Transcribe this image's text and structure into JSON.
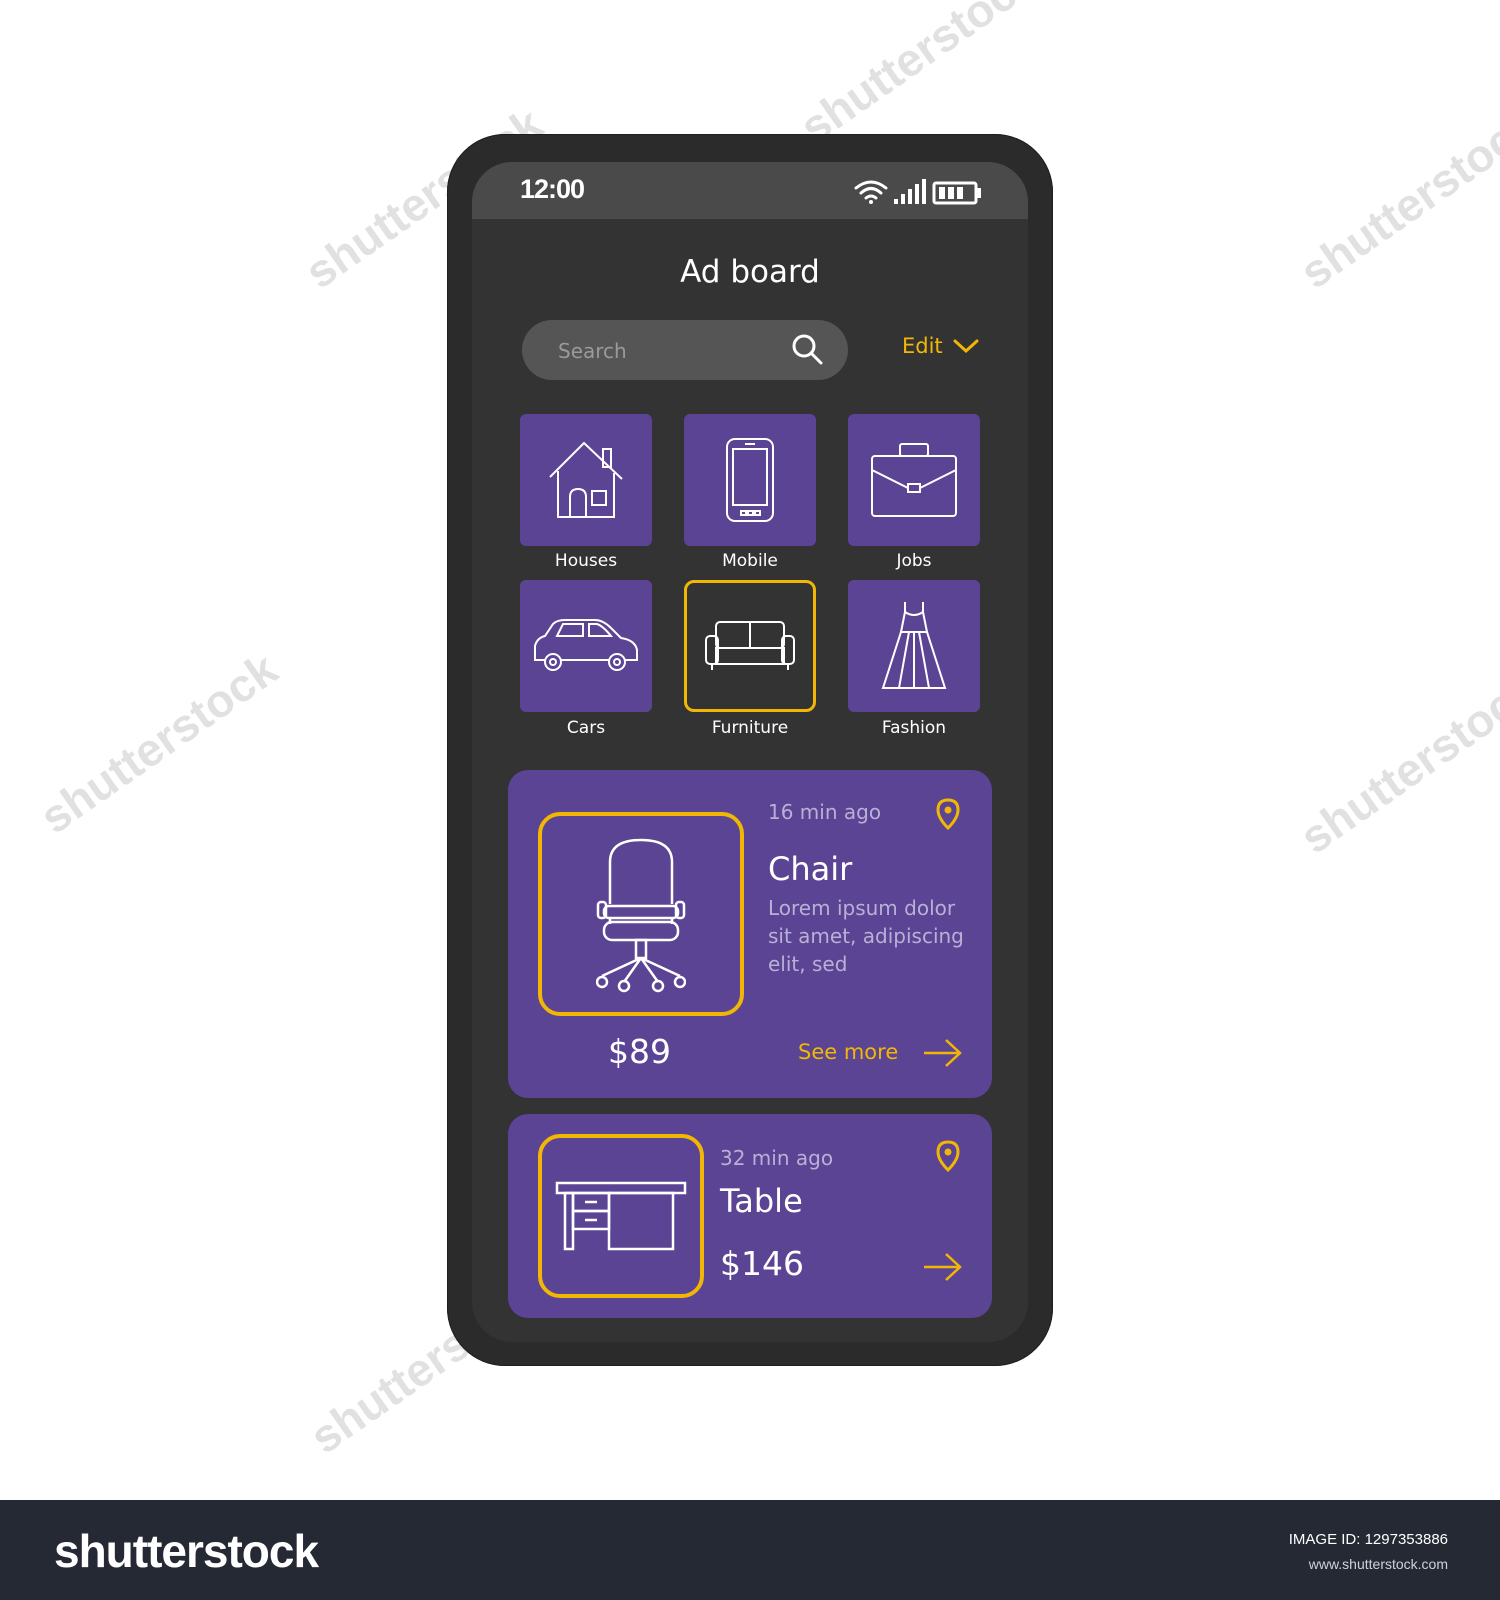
{
  "status_bar": {
    "time": "12:00",
    "icons": [
      "wifi-icon",
      "signal-icon",
      "battery-icon"
    ]
  },
  "header": {
    "title": "Ad board"
  },
  "search": {
    "placeholder": "Search",
    "icon": "search-icon"
  },
  "edit": {
    "label": "Edit",
    "icon": "chevron-down-icon"
  },
  "categories": [
    {
      "label": "Houses",
      "icon": "house-icon",
      "selected": false
    },
    {
      "label": "Mobile",
      "icon": "smartphone-icon",
      "selected": false
    },
    {
      "label": "Jobs",
      "icon": "briefcase-icon",
      "selected": false
    },
    {
      "label": "Cars",
      "icon": "car-icon",
      "selected": false
    },
    {
      "label": "Furniture",
      "icon": "sofa-icon",
      "selected": true
    },
    {
      "label": "Fashion",
      "icon": "dress-icon",
      "selected": false
    }
  ],
  "listings": [
    {
      "time": "16 min ago",
      "title": "Chair",
      "description": "Lorem ipsum dolor sit amet, adipiscing elit, sed",
      "price": "$89",
      "action": "See more",
      "image_icon": "office-chair-icon"
    },
    {
      "time": "32 min ago",
      "title": "Table",
      "price": "$146",
      "image_icon": "desk-icon"
    }
  ],
  "footer": {
    "logo": "shutterstock",
    "image_id": "IMAGE ID: 1297353886",
    "site": "www.shutterstock.com"
  },
  "watermark": {
    "text": "shutterstock"
  },
  "colors": {
    "accent": "#f2b705",
    "purple": "#5b4494",
    "screen_bg": "#333333",
    "status_bar": "#4a4a4a",
    "search_bg": "#555555",
    "footer_bg": "#252934"
  }
}
